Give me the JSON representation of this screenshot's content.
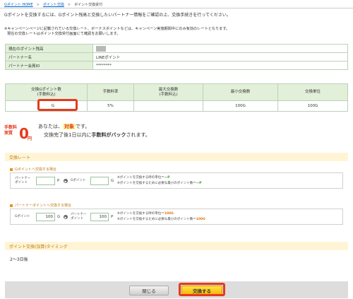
{
  "breadcrumb": {
    "home": "Gポイント HOME",
    "exchange": "ポイント交換",
    "current": "ポイント交換受付"
  },
  "intro": "Gポイントを交換するには、Gポイント残高と交換したいパートナー情報をご確認の上、交換手続きを行ってください。",
  "notes": [
    "※キャンペーンページに記載されている交換レート、ボーナスポイントなどは、キャンペーン実施期間中にのみ有効のレートとなります。",
    "現在の交換レートはポイント交換受付画面にて確認をお願いします。"
  ],
  "info_table": [
    {
      "label": "現在のポイント残高",
      "value": ""
    },
    {
      "label": "パートナー名",
      "value": "LINEポイント"
    },
    {
      "label": "パートナー会員ID",
      "value": "********"
    }
  ],
  "exchange_table": {
    "headers": [
      "交換Gポイント数\n(手数料込)",
      "手数料率",
      "最大交換数\n(手数料込)",
      "最小交換数",
      "交換単位"
    ],
    "row": [
      "G",
      "5%",
      "",
      "100G",
      "100G"
    ]
  },
  "fee": {
    "badge_top": "手数料",
    "badge_bottom": "実質",
    "badge_zero": "0",
    "badge_yen": "円",
    "line1_prefix": "あなたは、",
    "line1_tag": "対象",
    "line1_suffix": "です。",
    "line2_prefix": "交換完了後1日以内に",
    "line2_bold": "手数料がバック",
    "line2_suffix": "されます。"
  },
  "rate_section": {
    "title": "交換レート",
    "g_to_partner": {
      "title": "Gポイントへ交換する場合",
      "partner_label": "パートナー\nポイント",
      "partner_value": "",
      "partner_unit": "P",
      "gpoint_label": "Gポイント",
      "gpoint_value": "",
      "gpoint_unit": "G",
      "note1_prefix": "※ポイントを交換する時の単位＝",
      "note1_value": "―P",
      "note2_prefix": "※ポイントを交換するために必要な最小のポイント数＝",
      "note2_value": "―P"
    },
    "partner_to_g": {
      "title": "パートナーポイントへ交換する場合",
      "gpoint_label": "Gポイント",
      "gpoint_value": "100",
      "gpoint_unit": "G",
      "partner_label": "パートナー\nポイント",
      "partner_value": "100",
      "partner_unit": "P",
      "note1_prefix": "※ポイントを交換する時の単位＝",
      "note1_value": "100G",
      "note2_prefix": "※ポイントを交換するために必要な最小のポイント数＝",
      "note2_value": "100G"
    }
  },
  "timing": {
    "title": "ポイント交換(加算)タイミング",
    "text": "2〜3日後"
  },
  "buttons": {
    "close": "閉じる",
    "exchange": "交換する"
  },
  "colors": {
    "accent_green": "#e2f0d9",
    "highlight_red": "#e53a1e",
    "section_orange": "#c07a10"
  }
}
